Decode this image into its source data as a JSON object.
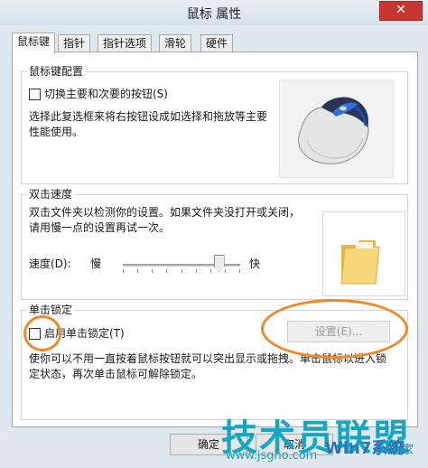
{
  "window": {
    "title": "鼠标 属性",
    "close_glyph": "✕"
  },
  "tabs": [
    "鼠标键",
    "指针",
    "指针选项",
    "滑轮",
    "硬件"
  ],
  "button_config": {
    "group_title": "鼠标键配置",
    "switch_label": "切换主要和次要的按钮(S)",
    "description": "选择此复选框来将右按钮设成如选择和拖放等主要性能使用。"
  },
  "double_click": {
    "group_title": "双击速度",
    "description": "双击文件夹以检测你的设置。如果文件夹没打开或关闭，请用慢一点的设置再试一次。",
    "speed_label": "速度(D):",
    "slow_label": "慢",
    "fast_label": "快",
    "speed_value_fraction": 0.82
  },
  "click_lock": {
    "group_title": "单击锁定",
    "enable_label": "启用单击锁定(T)",
    "settings_button": "设置(E)...",
    "description": "使你可以不用一直按着鼠标按钮就可以突出显示或拖拽。单击鼠标以进入锁定状态，再次单击鼠标可解除锁定。"
  },
  "footer": {
    "ok_button": "确定",
    "cancel_button": "取消"
  },
  "watermark": {
    "main": "技术员联盟",
    "url": "www.jsgho.com",
    "brand": "Win7系统",
    "tail": "之家"
  },
  "colors": {
    "annotation_ring": "#ee8a2a",
    "watermark": "#16a6c0"
  }
}
